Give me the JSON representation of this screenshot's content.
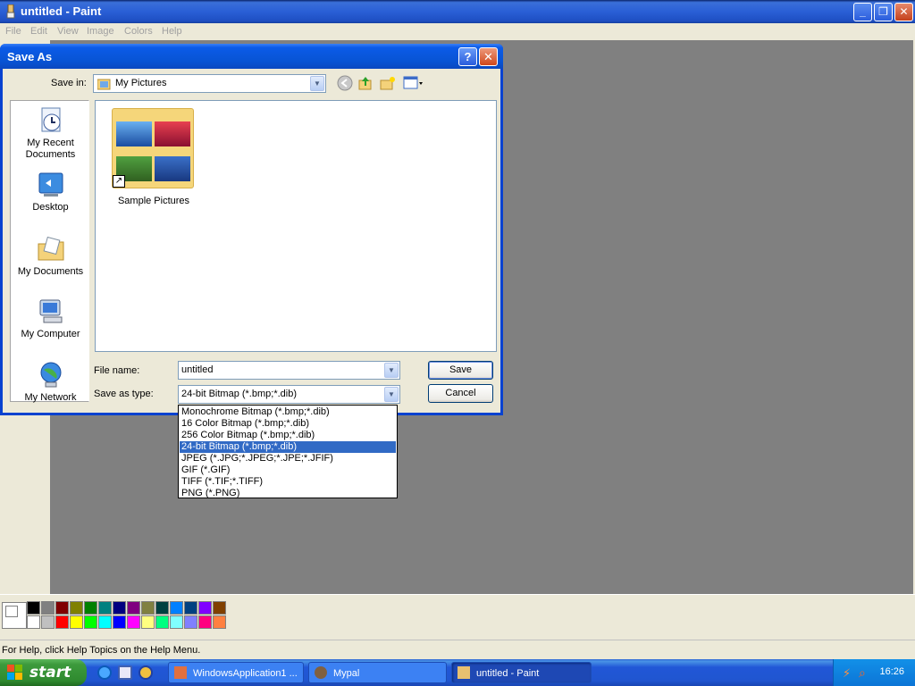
{
  "window": {
    "title": "untitled - Paint",
    "minimize_icon": "minimize-icon",
    "restore_icon": "restore-icon",
    "close_icon": "close-icon"
  },
  "menu": {
    "items": [
      "File",
      "Edit",
      "View",
      "Image",
      "Colors",
      "Help"
    ]
  },
  "dialog": {
    "title": "Save As",
    "help_glyph": "?",
    "close_glyph": "✕",
    "save_in_label": "Save in:",
    "save_in_value": "My Pictures",
    "places": [
      {
        "label": "My Recent Documents",
        "icon": "recent-documents-icon"
      },
      {
        "label": "Desktop",
        "icon": "desktop-icon"
      },
      {
        "label": "My Documents",
        "icon": "my-documents-icon"
      },
      {
        "label": "My Computer",
        "icon": "my-computer-icon"
      },
      {
        "label": "My Network",
        "icon": "my-network-icon"
      }
    ],
    "files": [
      {
        "name": "Sample Pictures",
        "icon": "folder-shortcut-icon"
      }
    ],
    "file_name_label": "File name:",
    "file_name_value": "untitled",
    "save_type_label": "Save as type:",
    "save_type_value": "24-bit Bitmap (*.bmp;*.dib)",
    "save_button": "Save",
    "cancel_button": "Cancel",
    "type_options": [
      "Monochrome Bitmap (*.bmp;*.dib)",
      "16 Color Bitmap (*.bmp;*.dib)",
      "256 Color Bitmap (*.bmp;*.dib)",
      "24-bit Bitmap (*.bmp;*.dib)",
      "JPEG (*.JPG;*.JPEG;*.JPE;*.JFIF)",
      "GIF (*.GIF)",
      "TIFF (*.TIF;*.TIFF)",
      "PNG (*.PNG)"
    ],
    "selected_type_index": 3
  },
  "palette": {
    "colors_top": [
      "#000000",
      "#808080",
      "#800000",
      "#808000",
      "#008000",
      "#008080",
      "#000080",
      "#800080",
      "#808040",
      "#004040",
      "#0080ff",
      "#004080",
      "#8000ff",
      "#804000"
    ],
    "colors_bottom": [
      "#ffffff",
      "#c0c0c0",
      "#ff0000",
      "#ffff00",
      "#00ff00",
      "#00ffff",
      "#0000ff",
      "#ff00ff",
      "#ffff80",
      "#00ff80",
      "#80ffff",
      "#8080ff",
      "#ff0080",
      "#ff8040"
    ]
  },
  "status": {
    "text": "For Help, click Help Topics on the Help Menu."
  },
  "taskbar": {
    "start_label": "start",
    "tasks": [
      {
        "label": "WindowsApplication1 ...",
        "active": false
      },
      {
        "label": "Mypal",
        "active": false
      },
      {
        "label": "untitled - Paint",
        "active": true
      }
    ],
    "clock": "16:26"
  }
}
